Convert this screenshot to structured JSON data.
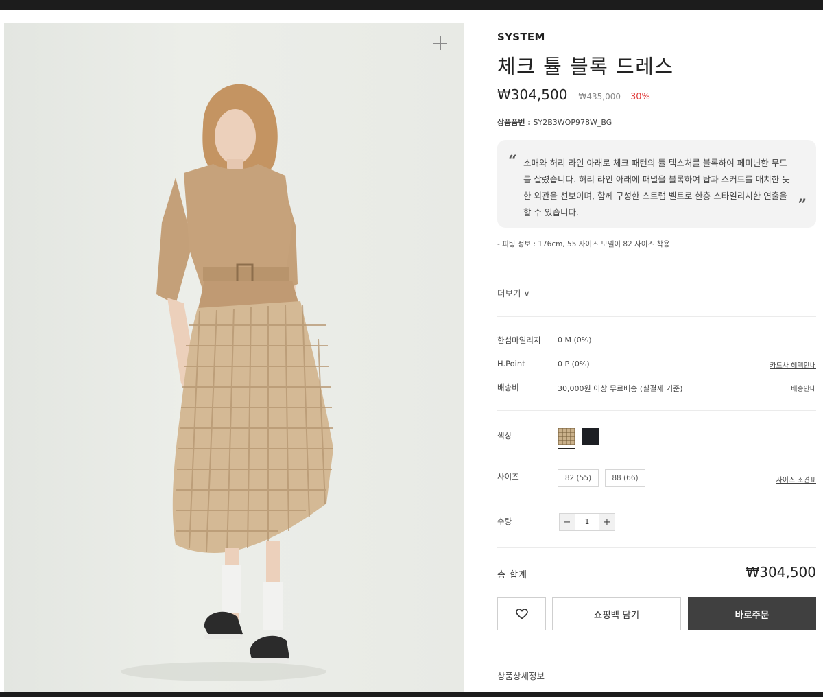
{
  "product": {
    "brand": "SYSTEM",
    "title": "체크 튤 블록 드레스",
    "sale_price": "₩304,500",
    "original_price": "₩435,000",
    "discount_rate": "30%",
    "code_label": "상품품번",
    "code_value": "SY2B3WOP978W_BG",
    "description": "소매와 허리 라인 아래로 체크 패턴의 튤 텍스처를 블록하여 페미닌한 무드를 살렸습니다. 허리 라인 아래에 패널을 블록하여 탑과 스커트를 매치한 듯한 외관을 선보이며, 함께 구성한 스트랩 벨트로 한층 스타일리시한 연출을 할 수 있습니다.",
    "quote_open": "“",
    "quote_close": "”",
    "fit_info": "- 피팅 정보 : 176cm, 55 사이즈 모델이 82 사이즈 착용",
    "more_label": "더보기 ∨"
  },
  "points": {
    "mileage_label": "한섬마일리지",
    "mileage_value": "0 M (0%)",
    "hpoint_label": "H.Point",
    "hpoint_value": "0 P (0%)",
    "card_link": "카드사 혜택안내",
    "shipping_label": "배송비",
    "shipping_value": "30,000원 이상 무료배송 (실결제 기준)",
    "shipping_link": "배송안내"
  },
  "options": {
    "color_label": "색상",
    "colors": [
      {
        "name": "beige-check",
        "hex": "#c9b08a",
        "selected": true
      },
      {
        "name": "black",
        "hex": "#1d1f24",
        "selected": false
      }
    ],
    "size_label": "사이즈",
    "sizes": [
      "82 (55)",
      "88 (66)"
    ],
    "size_guide_link": "사이즈 조견표",
    "qty_label": "수량",
    "qty_minus": "−",
    "qty_value": "1",
    "qty_plus": "+"
  },
  "summary": {
    "total_label": "총 합계",
    "total_value": "₩304,500"
  },
  "actions": {
    "wishlist_icon": "heart-icon",
    "cart_label": "쇼핑백 담기",
    "buy_label": "바로주문"
  },
  "detail": {
    "label": "상품상세정보"
  },
  "colors": {
    "accent_discount": "#e03c3c",
    "buy_button": "#404040",
    "description_bg": "#f3f3f3"
  }
}
